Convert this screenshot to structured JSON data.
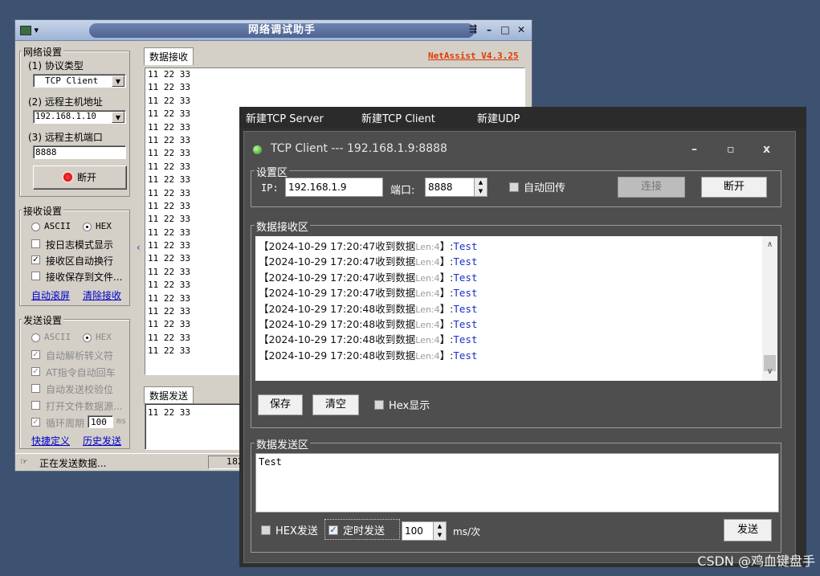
{
  "netassist": {
    "title": "网络调试助手",
    "version": "NetAssist V4.3.25",
    "net_settings": {
      "title": "网络设置",
      "protocol_label": "(1) 协议类型",
      "protocol_value": "TCP Client",
      "host_label": "(2) 远程主机地址",
      "host_value": "192.168.1.10",
      "port_label": "(3) 远程主机端口",
      "port_value": "8888",
      "disconnect_label": "断开"
    },
    "recv_settings": {
      "title": "接收设置",
      "ascii": "ASCII",
      "hex": "HEX",
      "log_mode": "按日志模式显示",
      "auto_wrap": "接收区自动换行",
      "save_file": "接收保存到文件...",
      "auto_scroll": "自动滚屏",
      "clear_recv": "清除接收"
    },
    "send_settings": {
      "title": "发送设置",
      "ascii": "ASCII",
      "hex": "HEX",
      "auto_escape": "自动解析转义符",
      "at_cmd": "AT指令自动回车",
      "checksum": "自动发送校验位",
      "open_file": "打开文件数据源...",
      "cycle": "循环周期",
      "cycle_value": "100",
      "cycle_unit": "ms",
      "shortcut": "快捷定义",
      "history": "历史发送"
    },
    "recv_tab": "数据接收",
    "recv_lines": [
      "11 22 33",
      "11 22 33",
      "11 22 33",
      "11 22 33",
      "11 22 33",
      "11 22 33",
      "11 22 33",
      "11 22 33",
      "11 22 33",
      "11 22 33",
      "11 22 33",
      "11 22 33",
      "11 22 33",
      "11 22 33",
      "11 22 33",
      "11 22 33",
      "11 22 33",
      "11 22 33",
      "11 22 33",
      "11 22 33",
      "11 22 33",
      "11 22 33"
    ],
    "send_tab": "数据发送",
    "send_text": "11 22 33",
    "status_text": "正在发送数据...",
    "status_count": "182"
  },
  "tcp_client": {
    "menu": [
      "新建TCP Server",
      "新建TCP Client",
      "新建UDP"
    ],
    "title": "TCP Client --- 192.168.1.9:8888",
    "controls": {
      "minimize": "–",
      "maximize": "▫",
      "close": "x"
    },
    "settings": {
      "title": "设置区",
      "ip_label": "IP:",
      "ip_value": "192.168.1.9",
      "port_label": "端口:",
      "port_value": "8888",
      "auto_echo": "自动回传",
      "connect": "连接",
      "disconnect": "断开"
    },
    "recv": {
      "title": "数据接收区",
      "rows": [
        {
          "ts": "【2024-10-29 17:20:47收到数据",
          "len": "Len:4",
          "end": "】:",
          "text": "Test"
        },
        {
          "ts": "【2024-10-29 17:20:47收到数据",
          "len": "Len:4",
          "end": "】:",
          "text": "Test"
        },
        {
          "ts": "【2024-10-29 17:20:47收到数据",
          "len": "Len:4",
          "end": "】:",
          "text": "Test"
        },
        {
          "ts": "【2024-10-29 17:20:47收到数据",
          "len": "Len:4",
          "end": "】:",
          "text": "Test"
        },
        {
          "ts": "【2024-10-29 17:20:48收到数据",
          "len": "Len:4",
          "end": "】:",
          "text": "Test"
        },
        {
          "ts": "【2024-10-29 17:20:48收到数据",
          "len": "Len:4",
          "end": "】:",
          "text": "Test"
        },
        {
          "ts": "【2024-10-29 17:20:48收到数据",
          "len": "Len:4",
          "end": "】:",
          "text": "Test"
        },
        {
          "ts": "【2024-10-29 17:20:48收到数据",
          "len": "Len:4",
          "end": "】:",
          "text": "Test"
        }
      ],
      "save": "保存",
      "clear": "清空",
      "hex_display": "Hex显示"
    },
    "send": {
      "title": "数据发送区",
      "text": "Test",
      "hex_send": "HEX发送",
      "timed_send": "定时发送",
      "interval": "100",
      "unit": "ms/次",
      "send": "发送"
    }
  },
  "watermark": "CSDN @鸡血键盘手"
}
